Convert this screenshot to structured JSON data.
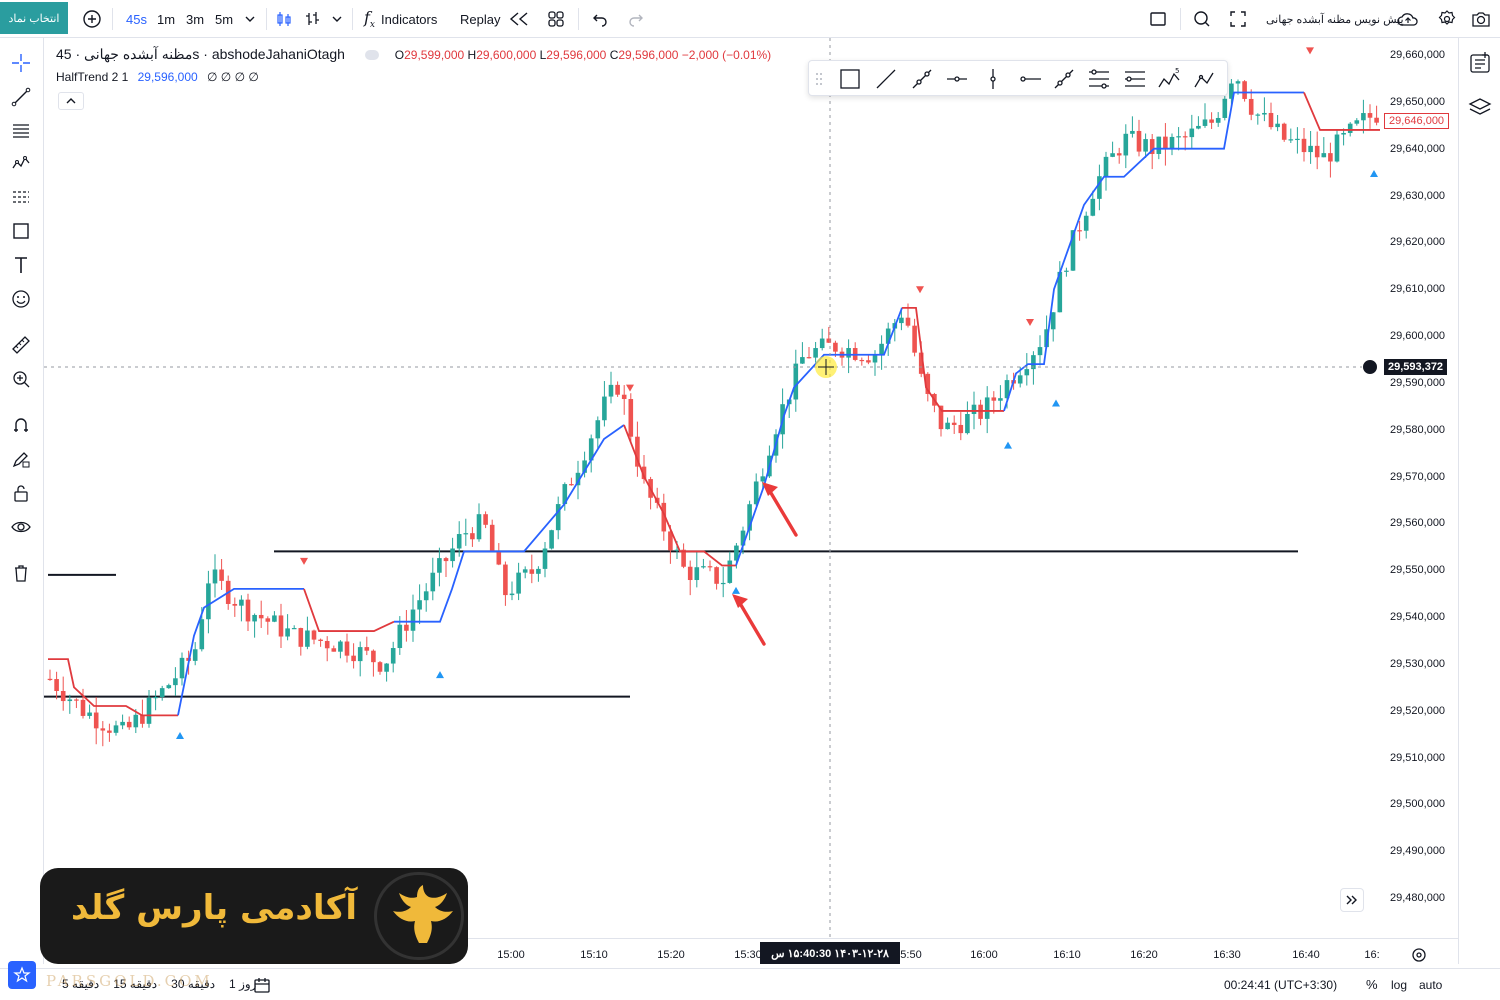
{
  "topbar": {
    "symbol_button": "انتخاب نماد",
    "intervals": [
      "45s",
      "1m",
      "3m",
      "5m"
    ],
    "active_interval": "45s",
    "indicators_label": "Indicators",
    "replay_label": "Replay",
    "right_title": "پیش نویس مظنه آبشده جهانی"
  },
  "legend": {
    "symbol": "مظنه آبشده جهانی · 45s · abshodeJahaniOtagh",
    "open_label": "O",
    "open": "29,599,000",
    "high_label": "H",
    "high": "29,600,000",
    "low_label": "L",
    "low": "29,596,000",
    "close_label": "C",
    "close": "29,596,000",
    "change": "−2,000 (−0.01%)",
    "indicator_name": "HalfTrend 2 1",
    "indicator_value": "29,596,000",
    "indicator_extra": "∅ ∅ ∅ ∅"
  },
  "price_scale": {
    "labels": [
      "29,660,000",
      "29,650,000",
      "29,640,000",
      "29,630,000",
      "29,620,000",
      "29,610,000",
      "29,600,000",
      "29,590,000",
      "29,580,000",
      "29,570,000",
      "29,560,000",
      "29,550,000",
      "29,540,000",
      "29,530,000",
      "29,520,000",
      "29,510,000",
      "29,500,000",
      "29,490,000",
      "29,480,000"
    ],
    "last_price_tag": "29,646,000",
    "crosshair_price_tag": "29,593,372"
  },
  "time_axis": {
    "labels": [
      "15:00",
      "15:10",
      "15:20",
      "15:30",
      "5:50",
      "16:00",
      "16:10",
      "16:20",
      "16:30",
      "16:40",
      "16:"
    ],
    "crosshair_label": "۱۴۰۳-۱۲-۲۸ ۱۵:40:30 س"
  },
  "bottombar": {
    "ranges": [
      "روز 1",
      "دقیقه 30",
      "دقیقه 15",
      "دقیقه 5"
    ],
    "clock": "00:24:41 (UTC+3:30)",
    "percent": "%",
    "log": "log",
    "auto": "auto"
  },
  "logo": {
    "text": "آکادمی پارس گلد",
    "watermark": "PARSGOLD.COM"
  },
  "colors": {
    "up": "#26a69a",
    "down": "#ef5350",
    "trend_up": "#2962ff",
    "trend_down": "#e03a3e",
    "accent": "#2a9d9f"
  },
  "chart_data": {
    "type": "candlestick",
    "ylim": [
      29475000,
      29665000
    ],
    "hlines": [
      29554000,
      29523000,
      29549000
    ],
    "crosshair_time": "15:40:30",
    "crosshair_price": 29593372
  }
}
